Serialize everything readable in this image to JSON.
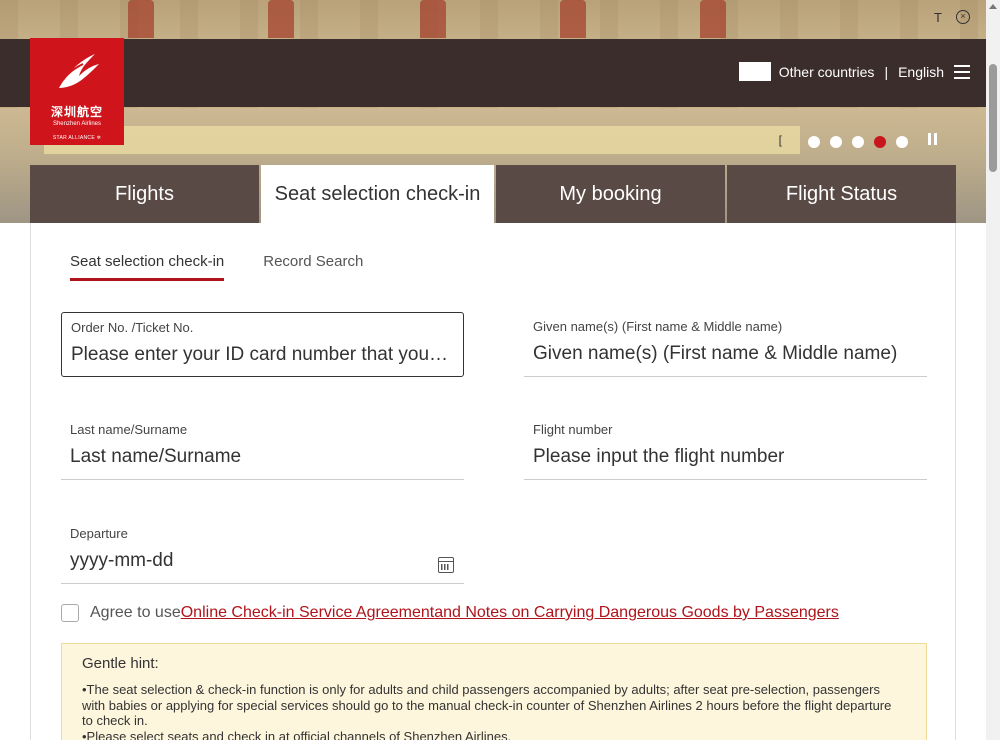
{
  "top_util": {
    "translate_glyph": "T",
    "close_glyph": "×"
  },
  "logo": {
    "cn": "深圳航空",
    "en": "Shenzhen Airlines",
    "alliance": "STAR ALLIANCE ✲"
  },
  "nav": {
    "country": "Other countries",
    "separator": "|",
    "language": "English"
  },
  "notice": {
    "glyph": "["
  },
  "carousel": {
    "count": 5,
    "active_index": 3
  },
  "main_tabs": [
    {
      "label": "Flights",
      "active": false
    },
    {
      "label": "Seat selection check-in",
      "active": true
    },
    {
      "label": "My booking",
      "active": false
    },
    {
      "label": "Flight Status",
      "active": false
    }
  ],
  "sub_tabs": [
    {
      "label": "Seat selection check-in",
      "active": true
    },
    {
      "label": "Record Search",
      "active": false
    }
  ],
  "form": {
    "order": {
      "label": "Order No. /Ticket No.",
      "placeholder": "Please enter your ID card number that you used when booking"
    },
    "given": {
      "label": "Given name(s) (First name & Middle name)",
      "placeholder": "Given name(s) (First name & Middle name)"
    },
    "last": {
      "label": "Last name/Surname",
      "placeholder": "Last name/Surname"
    },
    "flight": {
      "label": "Flight number",
      "placeholder": "Please input the flight number"
    },
    "departure": {
      "label": "Departure",
      "placeholder": "yyyy-mm-dd"
    }
  },
  "agree": {
    "prefix": "Agree to use",
    "link1": "Online Check-in Service Agreement",
    "link2": "and Notes on Carrying Dangerous Goods by Passengers"
  },
  "hint": {
    "title": "Gentle hint:",
    "line1": "•The seat selection & check-in function is only for adults and child passengers accompanied by adults; after seat pre-selection, passengers with babies or applying for special services should go to the manual check-in counter of Shenzhen Airlines 2 hours before the flight departure to check in.",
    "line2": "•Please select seats and check in at official channels of Shenzhen Airlines."
  },
  "colors": {
    "brand_red": "#d0141b",
    "nav_bg": "#3a2d2b",
    "tab_bg": "#5a4a45",
    "active_dot": "#c8161d"
  }
}
